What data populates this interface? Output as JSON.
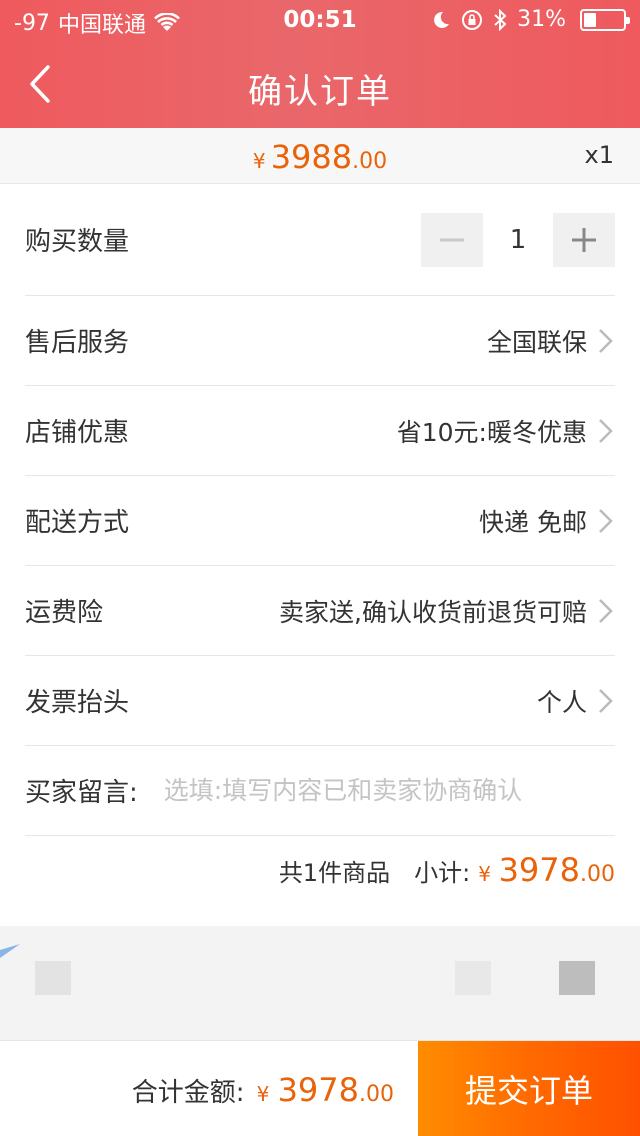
{
  "status_bar": {
    "signal": "-97",
    "carrier": "中国联通",
    "time": "00:51",
    "battery_percent": "31%",
    "battery_level": 0.31
  },
  "nav": {
    "title": "确认订单"
  },
  "product": {
    "price_currency": "¥",
    "price_int": "3988",
    "price_dec": ".00",
    "quantity_badge": "x1"
  },
  "form": {
    "quantity": {
      "label": "购买数量",
      "value": "1"
    },
    "after_sales": {
      "label": "售后服务",
      "value": "全国联保"
    },
    "store_discount": {
      "label": "店铺优惠",
      "value": "省10元:暖冬优惠"
    },
    "delivery": {
      "label": "配送方式",
      "value": "快递 免邮"
    },
    "shipping_insurance": {
      "label": "运费险",
      "value": "卖家送,确认收货前退货可赔"
    },
    "invoice": {
      "label": "发票抬头",
      "value": "个人"
    },
    "message": {
      "label": "买家留言:",
      "placeholder": "选填:填写内容已和卖家协商确认"
    }
  },
  "subtotal": {
    "count_text": "共1件商品",
    "label": "小计:",
    "currency": "¥",
    "amount_int": "3978",
    "amount_dec": ".00"
  },
  "footer": {
    "total_label": "合计金额:",
    "currency": "¥",
    "amount_int": "3978",
    "amount_dec": ".00",
    "submit_label": "提交订单"
  },
  "colors": {
    "header": "#ef5a5e",
    "price": "#e8630a",
    "submit": "#ff6a00"
  }
}
